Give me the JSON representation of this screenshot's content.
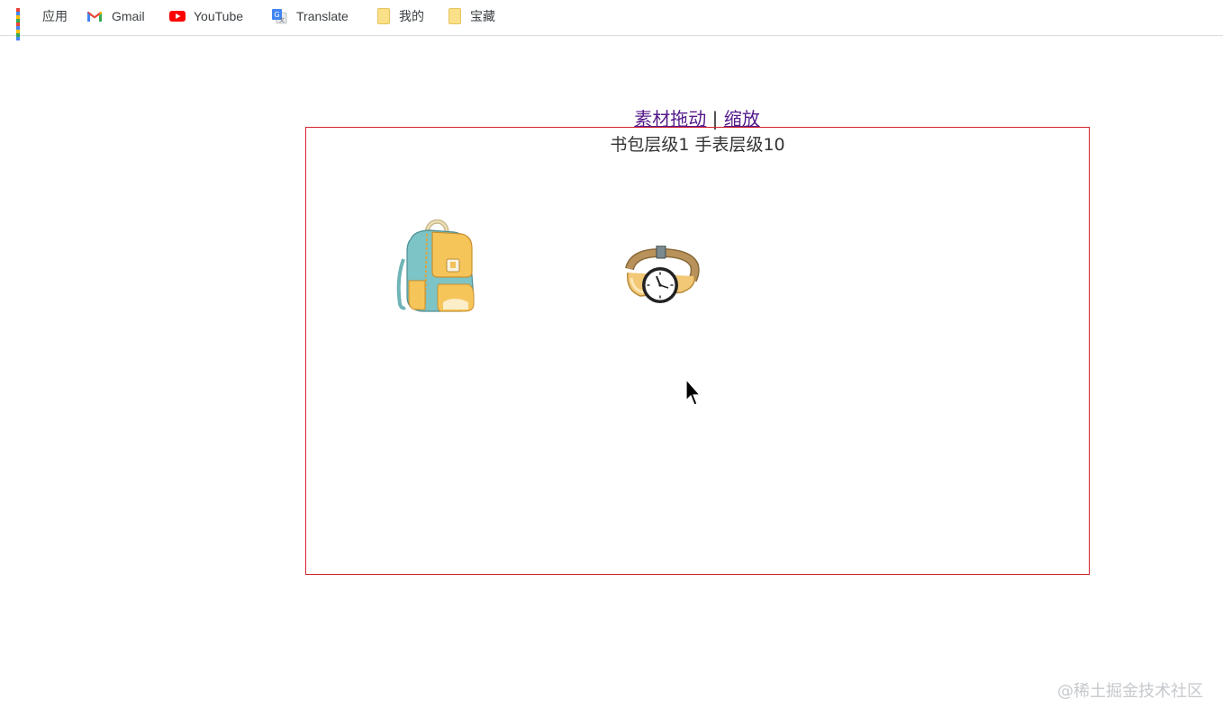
{
  "bookmarks": {
    "apps": "应用",
    "gmail": "Gmail",
    "youtube": "YouTube",
    "translate": "Translate",
    "mine": "我的",
    "treasure": "宝藏"
  },
  "nav": {
    "drag_link": "素材拖动",
    "separator": "|",
    "zoom_link": "缩放"
  },
  "stage": {
    "caption": "书包层级1 手表层级10",
    "border_color": "#d4242d"
  },
  "items": {
    "backpack_icon": "backpack-icon",
    "watch_icon": "watch-icon"
  },
  "watermark": "@稀土掘金技术社区"
}
